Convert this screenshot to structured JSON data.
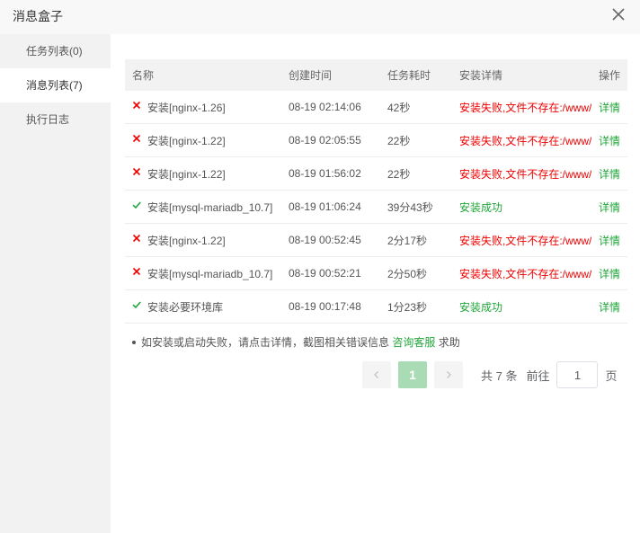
{
  "header": {
    "title": "消息盒子"
  },
  "sidebar": {
    "items": [
      {
        "label": "任务列表(0)"
      },
      {
        "label": "消息列表(7)"
      },
      {
        "label": "执行日志"
      }
    ]
  },
  "table": {
    "headers": [
      "名称",
      "创建时间",
      "任务耗时",
      "安装详情",
      "操作"
    ],
    "rows": [
      {
        "status": "fail",
        "name": "安装[nginx-1.26]",
        "time": "08-19 02:14:06",
        "duration": "42秒",
        "detail": "安装失败,文件不存在:/www/server/panel/install/nginx.sh",
        "op": "详情"
      },
      {
        "status": "fail",
        "name": "安装[nginx-1.22]",
        "time": "08-19 02:05:55",
        "duration": "22秒",
        "detail": "安装失败,文件不存在:/www/server/panel/install/nginx.sh",
        "op": "详情"
      },
      {
        "status": "fail",
        "name": "安装[nginx-1.22]",
        "time": "08-19 01:56:02",
        "duration": "22秒",
        "detail": "安装失败,文件不存在:/www/server/panel/install/nginx.sh",
        "op": "详情"
      },
      {
        "status": "ok",
        "name": "安装[mysql-mariadb_10.7]",
        "time": "08-19 01:06:24",
        "duration": "39分43秒",
        "detail": "安装成功",
        "op": "详情"
      },
      {
        "status": "fail",
        "name": "安装[nginx-1.22]",
        "time": "08-19 00:52:45",
        "duration": "2分17秒",
        "detail": "安装失败,文件不存在:/www/server/panel/install/nginx.sh",
        "op": "详情"
      },
      {
        "status": "fail",
        "name": "安装[mysql-mariadb_10.7]",
        "time": "08-19 00:52:21",
        "duration": "2分50秒",
        "detail": "安装失败,文件不存在:/www/server/panel/install/mysql.sh",
        "op": "详情"
      },
      {
        "status": "ok",
        "name": "安装必要环境库",
        "time": "08-19 00:17:48",
        "duration": "1分23秒",
        "detail": "安装成功",
        "op": "详情"
      }
    ]
  },
  "tip": {
    "before": "如安装或启动失败，请点击详情，截图相关错误信息",
    "link": "咨询客服",
    "after": "求助"
  },
  "pagination": {
    "current_page": "1",
    "total_text": "共 7 条",
    "goto_label": "前往",
    "goto_value": "1",
    "page_suffix": "页"
  },
  "colors": {
    "fail": "#e00000",
    "success": "#20a53a",
    "accent": "#20a53a"
  }
}
